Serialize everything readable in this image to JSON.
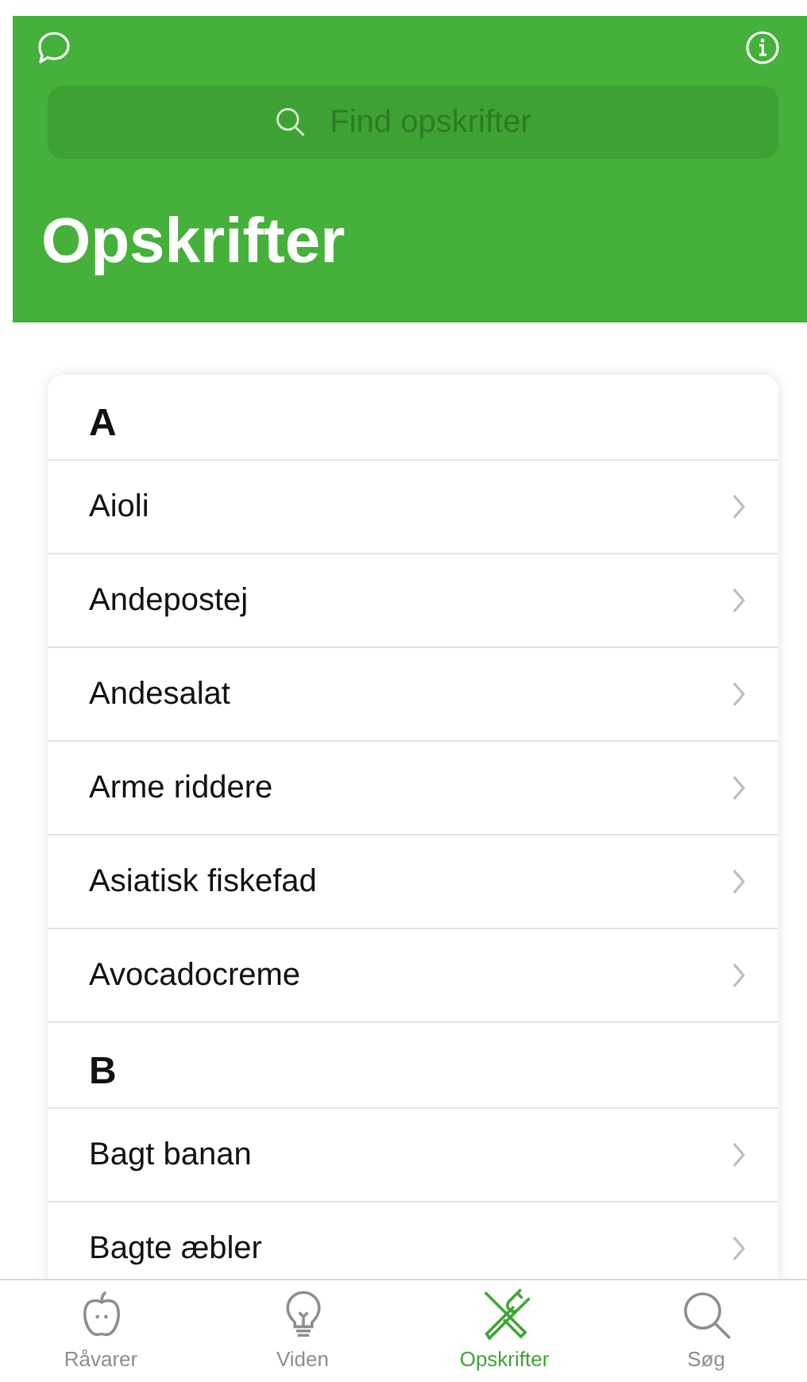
{
  "header": {
    "title": "Opskrifter",
    "search": {
      "placeholder": "Find opskrifter"
    }
  },
  "sections": [
    {
      "letter": "A",
      "items": [
        {
          "label": "Aioli"
        },
        {
          "label": "Andepostej"
        },
        {
          "label": "Andesalat"
        },
        {
          "label": "Arme riddere"
        },
        {
          "label": "Asiatisk fiskefad"
        },
        {
          "label": "Avocadocreme"
        }
      ]
    },
    {
      "letter": "B",
      "items": [
        {
          "label": "Bagt banan"
        },
        {
          "label": "Bagte æbler"
        }
      ]
    }
  ],
  "tabs": [
    {
      "kind": "apple",
      "label": "Råvarer",
      "selected": false
    },
    {
      "kind": "bulb",
      "label": "Viden",
      "selected": false
    },
    {
      "kind": "cutlery",
      "label": "Opskrifter",
      "selected": true
    },
    {
      "kind": "search",
      "label": "Søg",
      "selected": false
    }
  ]
}
